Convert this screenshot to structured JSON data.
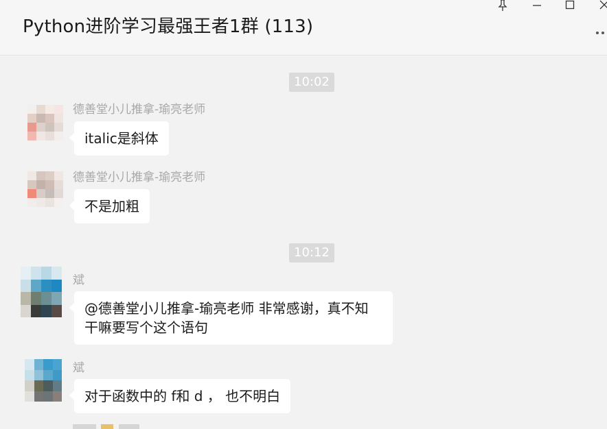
{
  "window": {
    "title": "Python进阶学习最强王者1群 (113)",
    "controls": {
      "pin_icon": "pin-icon",
      "minimize_icon": "minimize-icon",
      "maximize_icon": "maximize-icon",
      "close_icon": "close-icon",
      "more_icon": "more-icon"
    }
  },
  "timestamps": [
    "10:02",
    "10:12"
  ],
  "messages": [
    {
      "sender": "德善堂小儿推拿-瑜亮老师",
      "text": "italic是斜体"
    },
    {
      "sender": "德善堂小儿推拿-瑜亮老师",
      "text": "不是加粗"
    },
    {
      "sender": "斌",
      "text_line1": "@德善堂小儿推拿-瑜亮老师 非常感谢，真不知",
      "text_line2": "干嘛要写个这个语句"
    },
    {
      "sender": "斌",
      "text": "对于函数中的 f和 d ， 也不明白"
    }
  ],
  "colors": {
    "background": "#f2f2f2",
    "titlebar": "#f6f6f6",
    "bubble": "#ffffff",
    "timestamp_badge": "#dadada",
    "sender_text": "#a8a8a8"
  }
}
